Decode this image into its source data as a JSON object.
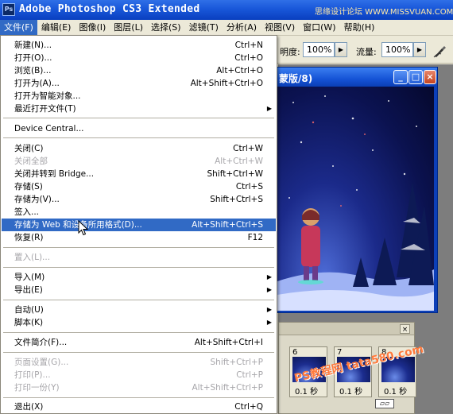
{
  "app": {
    "title": "Adobe Photoshop CS3 Extended",
    "logo": "Ps",
    "watermark": "思缘设计论坛 WWW.MISSVUAN.COM"
  },
  "menubar": [
    "文件(F)",
    "编辑(E)",
    "图像(I)",
    "图层(L)",
    "选择(S)",
    "滤镜(T)",
    "分析(A)",
    "视图(V)",
    "窗口(W)",
    "帮助(H)"
  ],
  "options": {
    "opacity_label": "明度:",
    "opacity_value": "100%",
    "flow_label": "流量:",
    "flow_value": "100%",
    "airbrush_icon": "airbrush-icon"
  },
  "document": {
    "title": "蒙版/8)"
  },
  "animation": {
    "frames": [
      {
        "num": "6",
        "time": "0.1 秒"
      },
      {
        "num": "7",
        "time": "0.1 秒"
      },
      {
        "num": "8",
        "time": "0.1 秒"
      }
    ],
    "watermark": "PS教程网 tata580.com"
  },
  "file_menu": {
    "new": {
      "label": "新建(N)...",
      "shortcut": "Ctrl+N"
    },
    "open": {
      "label": "打开(O)...",
      "shortcut": "Ctrl+O"
    },
    "browse": {
      "label": "浏览(B)...",
      "shortcut": "Alt+Ctrl+O"
    },
    "open_as": {
      "label": "打开为(A)...",
      "shortcut": "Alt+Shift+Ctrl+O"
    },
    "open_smart": {
      "label": "打开为智能对象..."
    },
    "recent": {
      "label": "最近打开文件(T)"
    },
    "device_central": {
      "label": "Device Central..."
    },
    "close": {
      "label": "关闭(C)",
      "shortcut": "Ctrl+W"
    },
    "close_all": {
      "label": "关闭全部",
      "shortcut": "Alt+Ctrl+W"
    },
    "close_bridge": {
      "label": "关闭并转到 Bridge...",
      "shortcut": "Shift+Ctrl+W"
    },
    "save": {
      "label": "存储(S)",
      "shortcut": "Ctrl+S"
    },
    "save_as": {
      "label": "存储为(V)...",
      "shortcut": "Shift+Ctrl+S"
    },
    "check_in": {
      "label": "签入..."
    },
    "save_web": {
      "label": "存储为 Web 和设备所用格式(D)...",
      "shortcut": "Alt+Shift+Ctrl+S"
    },
    "revert": {
      "label": "恢复(R)",
      "shortcut": "F12"
    },
    "place": {
      "label": "置入(L)..."
    },
    "import": {
      "label": "导入(M)"
    },
    "export": {
      "label": "导出(E)"
    },
    "automate": {
      "label": "自动(U)"
    },
    "scripts": {
      "label": "脚本(K)"
    },
    "file_info": {
      "label": "文件简介(F)...",
      "shortcut": "Alt+Shift+Ctrl+I"
    },
    "page_setup": {
      "label": "页面设置(G)...",
      "shortcut": "Shift+Ctrl+P"
    },
    "print": {
      "label": "打印(P)...",
      "shortcut": "Ctrl+P"
    },
    "print_one": {
      "label": "打印一份(Y)",
      "shortcut": "Alt+Shift+Ctrl+P"
    },
    "exit": {
      "label": "退出(X)",
      "shortcut": "Ctrl+Q"
    }
  }
}
